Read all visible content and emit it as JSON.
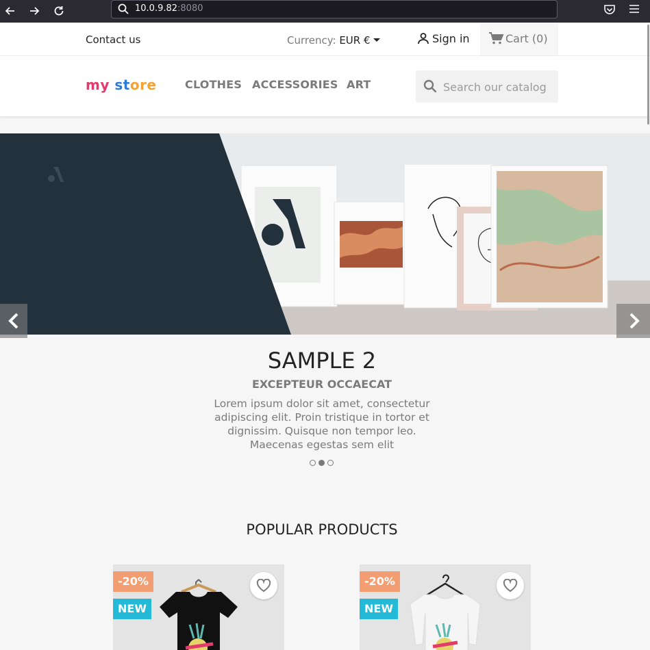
{
  "browser": {
    "url_host": "10.0.9.82",
    "url_port": ":8080",
    "icons": [
      "back-icon",
      "forward-icon",
      "reload-icon",
      "search-icon",
      "pocket-icon",
      "menu-icon"
    ]
  },
  "header": {
    "contact": "Contact us",
    "currency_label": "Currency:",
    "currency_value": "EUR €",
    "signin": "Sign in",
    "cart_label": "Cart",
    "cart_count": "(0)"
  },
  "logo": {
    "part1": "my",
    "part2": "st",
    "part3": "ore"
  },
  "nav": {
    "items": [
      "CLOTHES",
      "ACCESSORIES",
      "ART"
    ]
  },
  "search": {
    "placeholder": "Search our catalog"
  },
  "slider": {
    "title": "SAMPLE 2",
    "subtitle": "EXCEPTEUR OCCAECAT",
    "text": "Lorem ipsum dolor sit amet, consectetur adipiscing elit. Proin tristique in tortor et dignissim. Quisque non tempor leo. Maecenas egestas sem elit",
    "slide_count": 3,
    "active_slide": 2
  },
  "popular": {
    "title": "POPULAR PRODUCTS",
    "products": [
      {
        "discount": "-20%",
        "badge": "NEW",
        "shirt_color": "#111111"
      },
      {
        "discount": "-20%",
        "badge": "NEW",
        "shirt_color": "#f5f5f5"
      }
    ]
  },
  "colors": {
    "accent_blue": "#24b9d7",
    "discount_orange": "#f39d72",
    "dark_navy": "#23313d"
  }
}
